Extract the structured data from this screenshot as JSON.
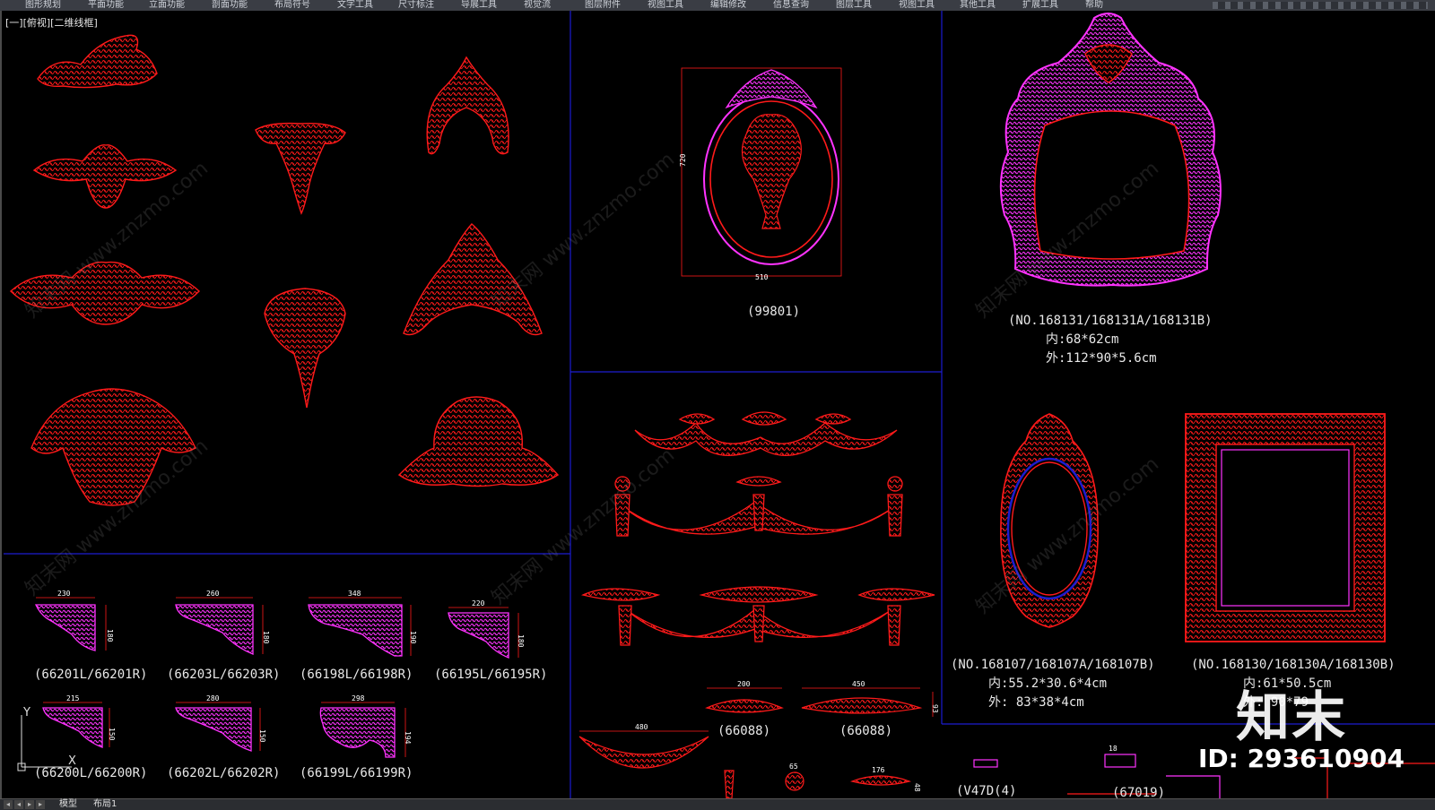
{
  "menubar": {
    "items": [
      "图形规划",
      "平面功能",
      "立面功能",
      "剖面功能",
      "布局符号",
      "文字工具",
      "尺寸标注",
      "导展工具",
      "视觉流",
      "图层附件",
      "视图工具",
      "编辑修改",
      "信息查询",
      "图层工具",
      "视图工具",
      "其他工具",
      "扩展工具",
      "帮助"
    ]
  },
  "viewport": {
    "view_label": "[一][俯视][二维线框]"
  },
  "labels": {
    "p99801": "(99801)",
    "no168131": "(NO.168131/168131A/168131B)",
    "inner168131": "内:68*62cm",
    "outer168131": "外:112*90*5.6cm",
    "no168107": "(NO.168107/168107A/168107B)",
    "inner168107": "内:55.2*30.6*4cm",
    "outer168107": "外: 83*38*4cm",
    "no168130": "(NO.168130/168130A/168130B)",
    "inner168130": "内:61*50.5cm",
    "outer168130": "外: 90*79",
    "c66201": "(66201L/66201R)",
    "c66203": "(66203L/66203R)",
    "c66198": "(66198L/66198R)",
    "c66195": "(66195L/66195R)",
    "c66200": "(66200L/66200R)",
    "c66202": "(66202L/66202R)",
    "c66199": "(66199L/66199R)",
    "c66088a": "(66088)",
    "c66088b": "(66088)",
    "bottom_partial": "(V47D(4)",
    "bottom_partial2": "(67019)"
  },
  "dims": {
    "d720": "720",
    "d510": "510",
    "d230": "230",
    "d180a": "180",
    "d260": "260",
    "d180b": "180",
    "d348": "348",
    "d190": "190",
    "d220": "220",
    "d180c": "180",
    "d215": "215",
    "d150a": "150",
    "d280": "280",
    "d150b": "150",
    "d298": "298",
    "d194": "194",
    "d200": "200",
    "d450": "450",
    "d93": "93",
    "d480": "480",
    "d65": "65",
    "d176": "176",
    "d48": "48",
    "d18": "18"
  },
  "tabs": {
    "model": "模型",
    "layout1": "布局1"
  },
  "watermark": {
    "logo": "知末",
    "id": "ID: 293610904",
    "tiled": "知末网 www.znzmo.com"
  },
  "ucs": {
    "y": "Y",
    "x": "X"
  },
  "colors": {
    "ornament_red": "#ff1a1a",
    "ornament_magenta": "#ff33ff",
    "frame_line_blue": "#1c1cd0",
    "background": "#000000"
  }
}
